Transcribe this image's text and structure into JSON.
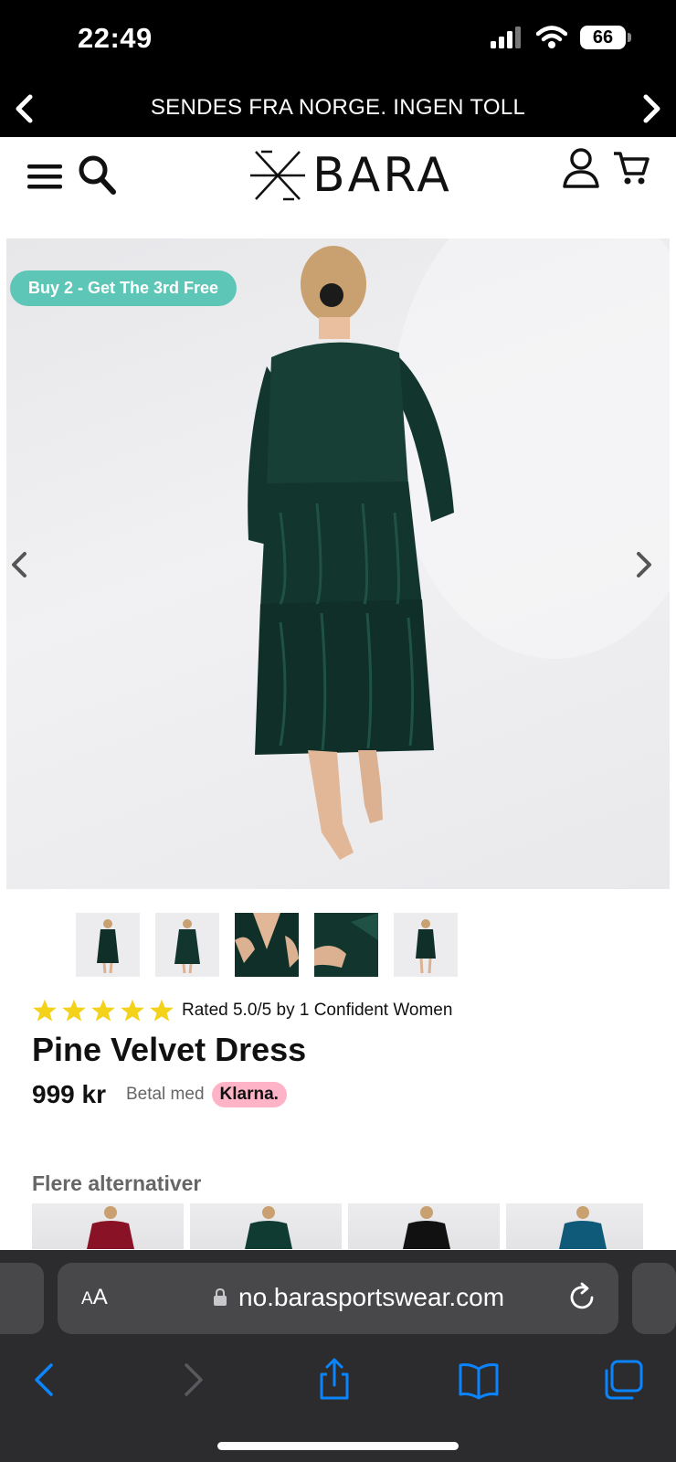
{
  "status_bar": {
    "time": "22:49",
    "battery": "66",
    "icons": [
      "cellular-signal-icon",
      "wifi-icon",
      "battery-icon"
    ]
  },
  "announcement": {
    "text": "SENDES FRA NORGE. INGEN TOLL",
    "icons": [
      "chevron-left-icon",
      "chevron-right-icon"
    ]
  },
  "header": {
    "brand": "BARA",
    "icons": [
      "menu-icon",
      "search-icon",
      "account-icon",
      "cart-icon"
    ]
  },
  "product_image": {
    "badge": "Buy 2 - Get The 3rd Free",
    "icons": [
      "carousel-prev-icon",
      "carousel-next-icon"
    ]
  },
  "thumbnails": [
    "thumb-back",
    "thumb-side",
    "thumb-neckline",
    "thumb-sleeve",
    "thumb-front"
  ],
  "product": {
    "stars": 5,
    "rating_text": "Rated 5.0/5 by 1 Confident Women",
    "title": "Pine Velvet Dress",
    "price": "999 kr",
    "pay_with": "Betal med",
    "klarna": "Klarna."
  },
  "alternatives": {
    "title": "Flere alternativer",
    "colors": [
      "#8a1226",
      "#0f3b33",
      "#111111",
      "#0f5a78"
    ]
  },
  "browser": {
    "aa_label": "AA",
    "url": "no.barasportswear.com",
    "icons": [
      "lock-icon",
      "reload-icon",
      "back-icon",
      "forward-icon",
      "share-icon",
      "bookmarks-icon",
      "tabs-icon"
    ]
  },
  "colors": {
    "badge": "#5ec6b6",
    "klarna": "#ffb3c7",
    "star": "#f5d21a",
    "safari_accent": "#0a84ff"
  }
}
